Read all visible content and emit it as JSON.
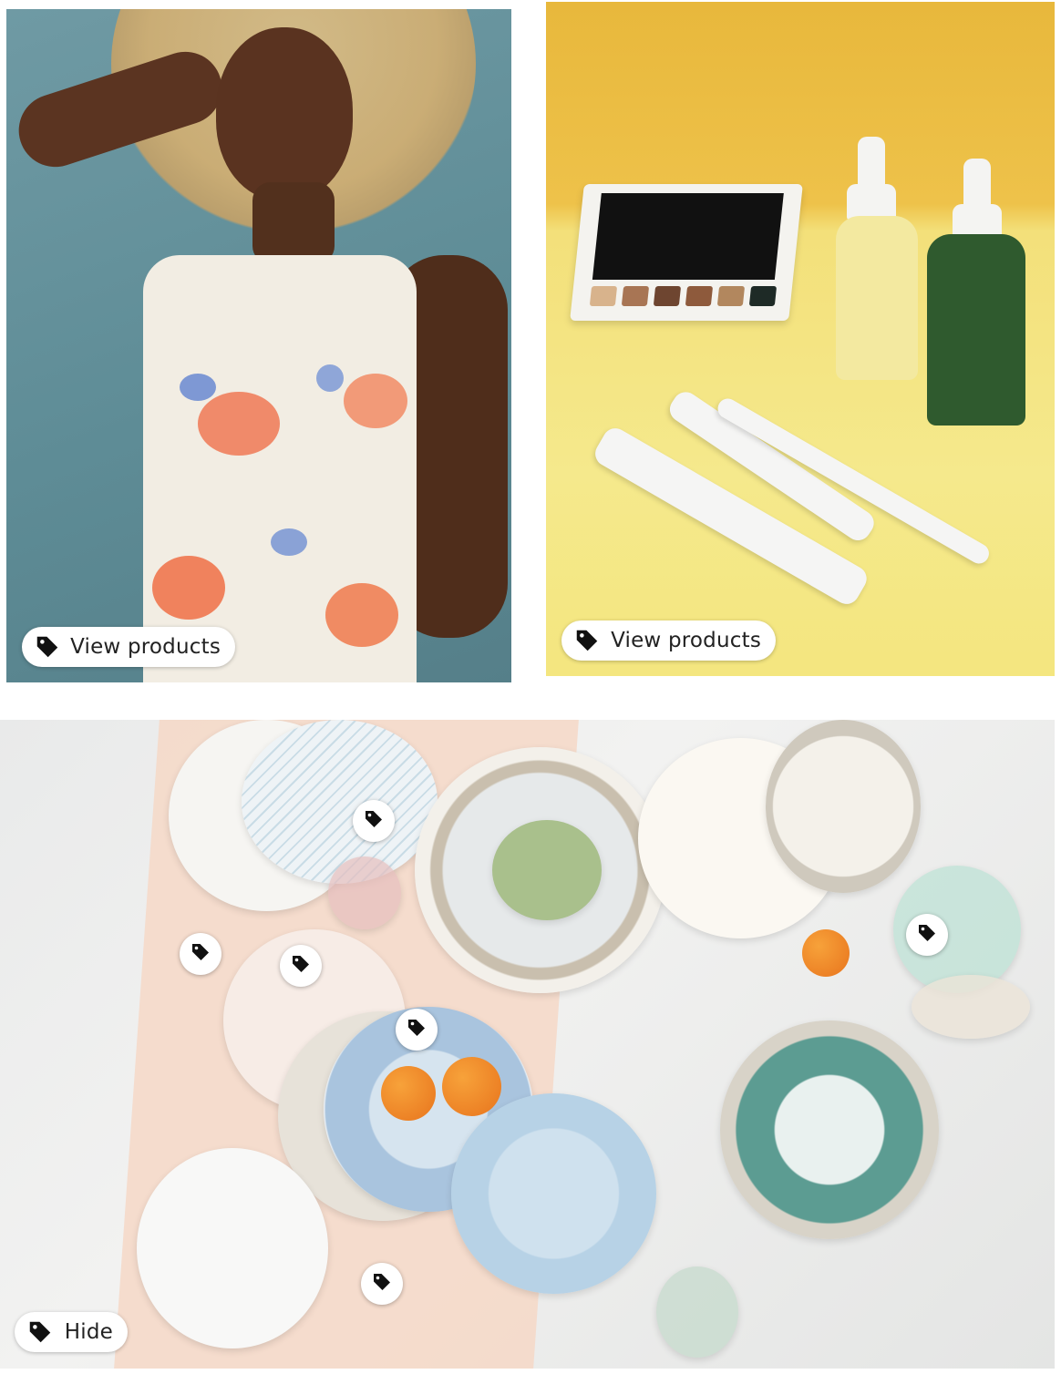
{
  "tiles": {
    "fashion": {
      "view_products_label": "View products",
      "icon": "tag-icon"
    },
    "beauty": {
      "view_products_label": "View products",
      "icon": "tag-icon"
    },
    "tabletop": {
      "hide_label": "Hide",
      "icon": "tag-icon",
      "hotspot_icon": "tag-icon"
    }
  },
  "colors": {
    "pill_background": "#ffffff",
    "pill_text": "#222222",
    "tag_icon": "#111111"
  }
}
